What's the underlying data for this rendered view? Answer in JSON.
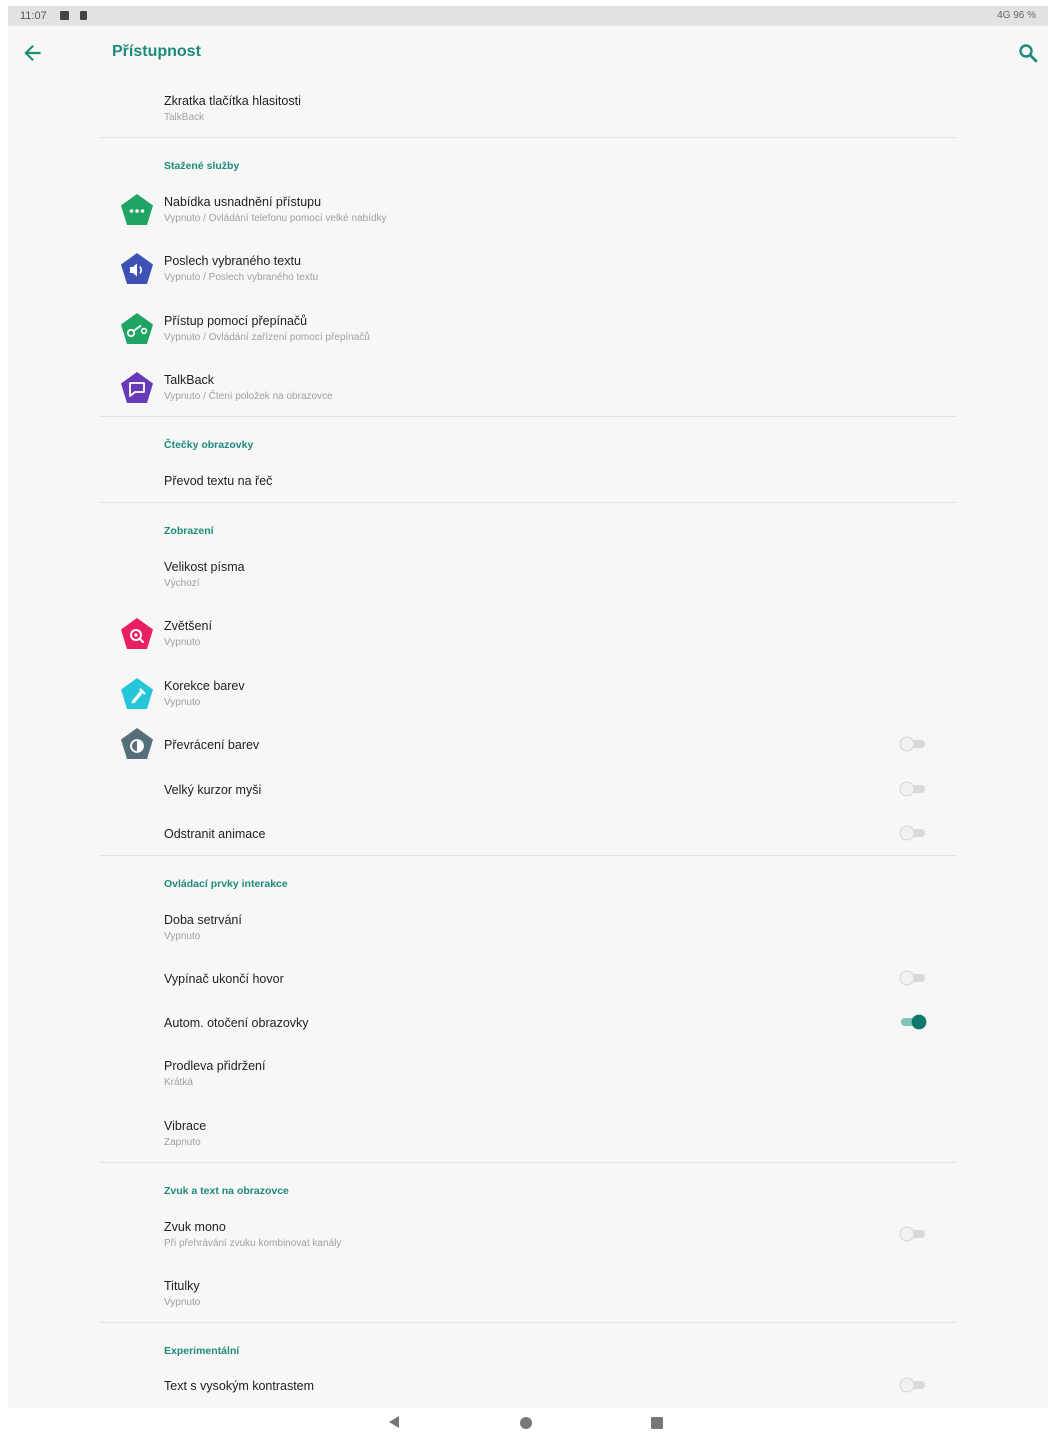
{
  "status_bar": {
    "time": "11:07",
    "right": "4G 96 %"
  },
  "app_bar": {
    "title": "Přístupnost"
  },
  "colors": {
    "accent": "#1e8a7a",
    "background": "#f7f7f7",
    "toggle_on": "#0f7a6c"
  },
  "items": {
    "volume_shortcut": {
      "title": "Zkratka tlačítka hlasitosti",
      "sub": "TalkBack"
    },
    "menu": {
      "title": "Nabídka usnadnění přístupu",
      "sub": "Vypnuto / Ovládání telefonu pomocí velké nabídky",
      "icon": "dots-icon",
      "color": "#1fa463"
    },
    "select_to_speak": {
      "title": "Poslech vybraného textu",
      "sub": "Vypnuto / Poslech vybraného textu",
      "icon": "speaker-icon",
      "color": "#3f51b5"
    },
    "switch_access": {
      "title": "Přístup pomocí přepínačů",
      "sub": "Vypnuto / Ovládání zařízení pomocí přepínačů",
      "icon": "switch-icon",
      "color": "#1fa463"
    },
    "talkback": {
      "title": "TalkBack",
      "sub": "Vypnuto / Čtení položek na obrazovce",
      "icon": "talkback-icon",
      "color": "#673ab7"
    },
    "tts": {
      "title": "Převod textu na řeč"
    },
    "font_size": {
      "title": "Velikost písma",
      "sub": "Výchozí"
    },
    "magnification": {
      "title": "Zvětšení",
      "sub": "Vypnuto",
      "icon": "magnify-icon",
      "color": "#e91e63"
    },
    "color_correction": {
      "title": "Korekce barev",
      "sub": "Vypnuto",
      "icon": "eyedropper-icon",
      "color": "#26c6da"
    },
    "color_inversion": {
      "title": "Převrácení barev",
      "icon": "contrast-icon",
      "color": "#546e7a",
      "checked": false
    },
    "large_cursor": {
      "title": "Velký kurzor myši",
      "checked": false
    },
    "remove_animations": {
      "title": "Odstranit animace",
      "checked": false
    },
    "dwell_timing": {
      "title": "Doba setrvání",
      "sub": "Vypnuto"
    },
    "power_ends_call": {
      "title": "Vypínač ukončí hovor",
      "checked": false
    },
    "auto_rotate": {
      "title": "Autom. otočení obrazovky",
      "checked": true
    },
    "touch_hold_delay": {
      "title": "Prodleva přidržení",
      "sub": "Krátká"
    },
    "vibration": {
      "title": "Vibrace",
      "sub": "Zapnuto"
    },
    "mono_audio": {
      "title": "Zvuk mono",
      "sub": "Při přehrávání zvuku kombinovat kanály",
      "checked": false
    },
    "captions": {
      "title": "Titulky",
      "sub": "Vypnuto"
    },
    "high_contrast": {
      "title": "Text s vysokým kontrastem",
      "checked": false
    }
  },
  "sections": {
    "downloaded": "Stažené služby",
    "screen_readers": "Čtečky obrazovky",
    "display": "Zobrazení",
    "interaction": "Ovládací prvky interakce",
    "audio": "Zvuk a text na obrazovce",
    "experimental": "Experimentální"
  }
}
